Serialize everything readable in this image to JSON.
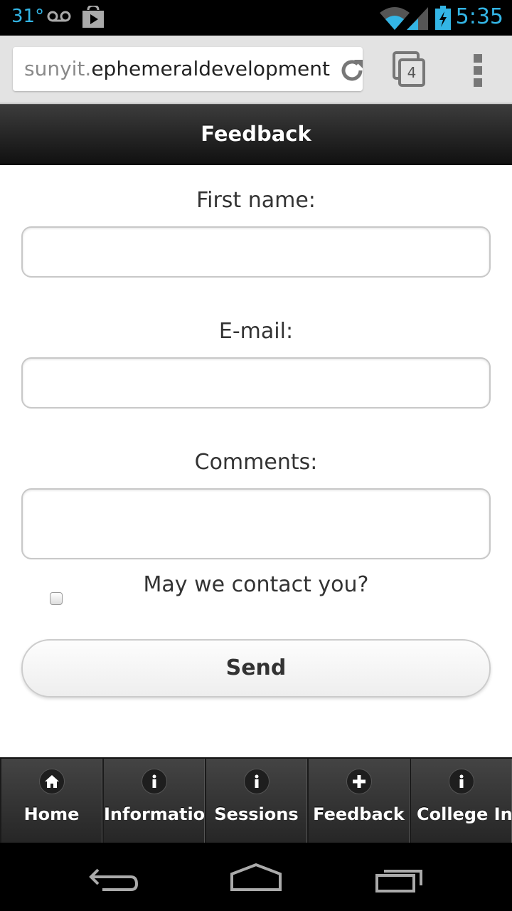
{
  "status_bar": {
    "temperature": "31°",
    "time": "5:35",
    "icons": [
      "voicemail-icon",
      "play-store-icon",
      "wifi-icon",
      "signal-icon",
      "battery-charging-icon"
    ]
  },
  "browser": {
    "url_host": "sunyit.",
    "url_domain": "ephemeraldevelopment",
    "tab_count": "4"
  },
  "header": {
    "title": "Feedback"
  },
  "form": {
    "first_name_label": "First name:",
    "first_name_value": "",
    "email_label": "E-mail:",
    "email_value": "",
    "comments_label": "Comments:",
    "comments_value": "",
    "contact_label": "May we contact you?",
    "contact_checked": false,
    "send_label": "Send"
  },
  "nav": {
    "items": [
      {
        "label": "Home",
        "icon": "home-icon"
      },
      {
        "label": "Information",
        "icon": "info-icon"
      },
      {
        "label": "Sessions",
        "icon": "info-icon"
      },
      {
        "label": "Feedback",
        "icon": "plus-icon"
      },
      {
        "label": "College Info",
        "icon": "info-icon"
      }
    ]
  },
  "colors": {
    "status_accent": "#33b5e5",
    "header_bg": "#1a1a1a",
    "nav_bg": "#2b2b2b"
  }
}
